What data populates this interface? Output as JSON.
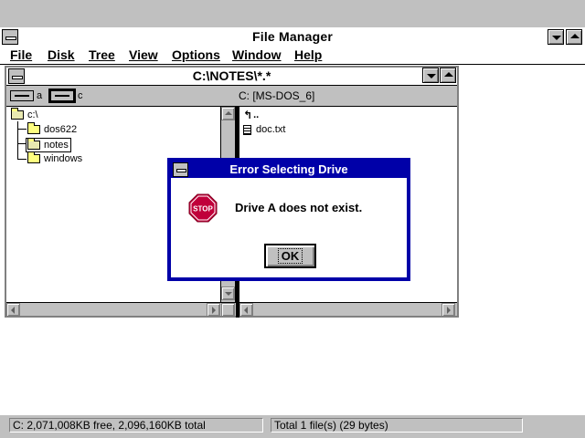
{
  "window": {
    "title": "File Manager",
    "menu": [
      "File",
      "Disk",
      "Tree",
      "View",
      "Options",
      "Window",
      "Help"
    ]
  },
  "child": {
    "title": "C:\\NOTES\\*.*",
    "drives": [
      {
        "letter": "a",
        "selected": false
      },
      {
        "letter": "c",
        "selected": true
      }
    ],
    "volume": "C: [MS-DOS_6]",
    "tree": {
      "root": "c:\\",
      "folders": [
        "dos622",
        "notes",
        "windows"
      ],
      "selected": "notes"
    },
    "files": {
      "parent": "..",
      "items": [
        "doc.txt"
      ]
    }
  },
  "status": {
    "disk": "C: 2,071,008KB free,  2,096,160KB total",
    "files": "Total 1 file(s) (29 bytes)"
  },
  "dialog": {
    "title": "Error Selecting Drive",
    "icon": "stop-icon",
    "icon_text": "STOP",
    "message": "Drive A does not exist.",
    "ok_label": "OK"
  },
  "colors": {
    "dialog_frame": "#0000a8",
    "stop_red": "#c0003a",
    "chrome": "#c0c0c0"
  }
}
